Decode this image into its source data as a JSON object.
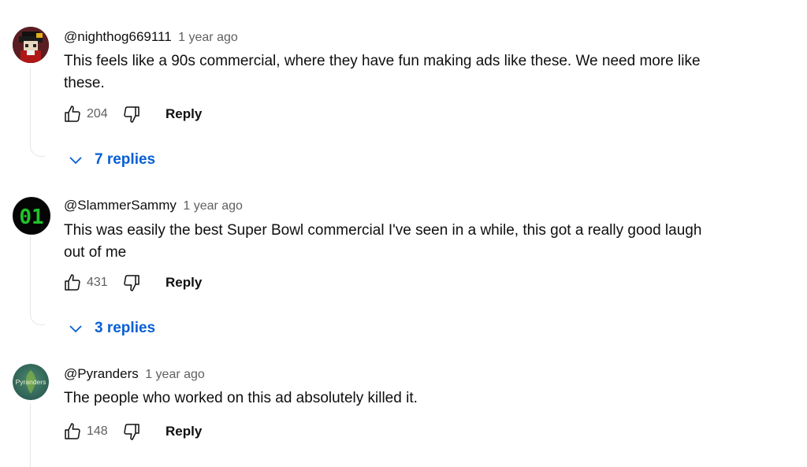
{
  "comments": [
    {
      "author": "@nighthog669111",
      "time": "1 year ago",
      "text": "This feels like a 90s commercial, where they have fun making ads like these. We need more like these.",
      "likes": "204",
      "reply_label": "Reply",
      "replies_label": "7 replies",
      "avatar_icon": "pixel-art-avatar-icon"
    },
    {
      "author": "@SlammerSammy",
      "time": "1 year ago",
      "text": "This was easily the best Super Bowl commercial I've seen in a while, this got a really good laugh out of me",
      "likes": "431",
      "reply_label": "Reply",
      "replies_label": "3 replies",
      "avatar_icon": "digital-01-avatar-icon",
      "avatar_text": "01"
    },
    {
      "author": "@Pyranders",
      "time": "1 year ago",
      "text": "The people who worked on this ad absolutely killed it.",
      "likes": "148",
      "reply_label": "Reply",
      "avatar_icon": "pyranders-avatar-icon",
      "avatar_text": "Pyranders"
    }
  ],
  "colors": {
    "link_blue": "#065fd4",
    "text_primary": "#0f0f0f",
    "text_secondary": "#606060",
    "avatar_green": "#1fc32a"
  }
}
